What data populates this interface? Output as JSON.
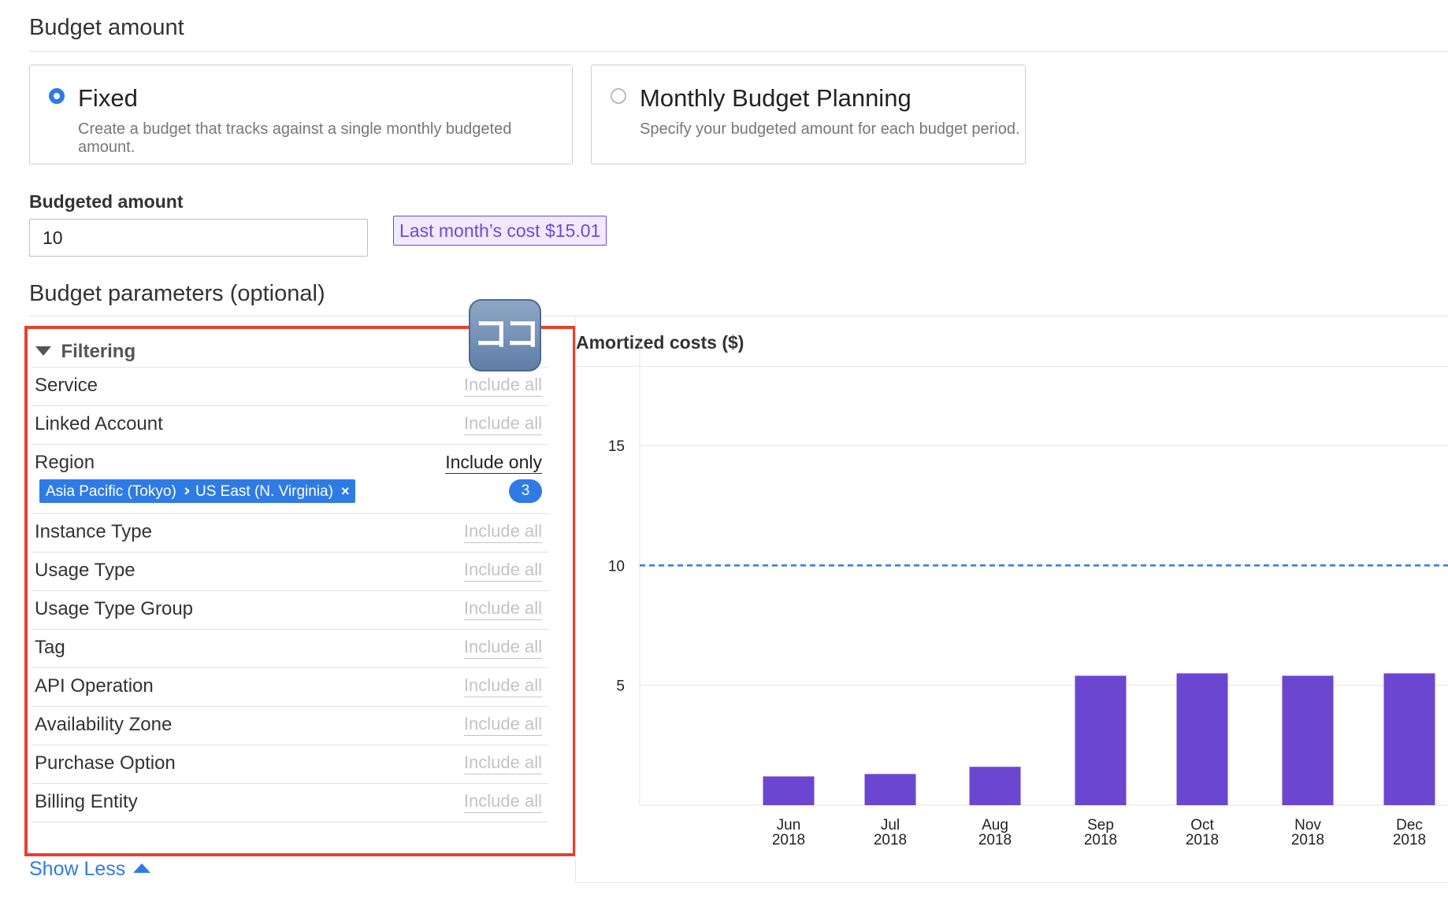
{
  "budget_amount": {
    "heading": "Budget amount",
    "options": [
      {
        "title": "Fixed",
        "description": "Create a budget that tracks against a single monthly budgeted amount.",
        "selected": true
      },
      {
        "title": "Monthly Budget Planning",
        "description": "Specify your budgeted amount for each budget period.",
        "selected": false
      }
    ],
    "budgeted_label": "Budgeted amount",
    "budgeted_value": "10",
    "last_month_cost": "Last month’s cost $15.01"
  },
  "parameters": {
    "heading": "Budget parameters (optional)",
    "filtering": {
      "title": "Filtering",
      "rows": [
        {
          "name": "Service",
          "value": "Include all"
        },
        {
          "name": "Linked Account",
          "value": "Include all"
        },
        {
          "name": "Region",
          "value": "Include only",
          "chips": [
            "Asia Pacific (Tokyo)",
            "US East (N. Virginia)"
          ],
          "count": "3"
        },
        {
          "name": "Instance Type",
          "value": "Include all"
        },
        {
          "name": "Usage Type",
          "value": "Include all"
        },
        {
          "name": "Usage Type Group",
          "value": "Include all"
        },
        {
          "name": "Tag",
          "value": "Include all"
        },
        {
          "name": "API Operation",
          "value": "Include all"
        },
        {
          "name": "Availability Zone",
          "value": "Include all"
        },
        {
          "name": "Purchase Option",
          "value": "Include all"
        },
        {
          "name": "Billing Entity",
          "value": "Include all"
        }
      ],
      "chip_remove_glyph": "×"
    },
    "koko_icon": "ココ",
    "show_less": "Show Less"
  },
  "colors": {
    "accent": "#2f7be6",
    "bar": "#6b46d1",
    "highlight_box": "#e8402b",
    "budget_line": "#2f7be6"
  },
  "chart_data": {
    "type": "bar",
    "title": "Amortized costs ($)",
    "categories": [
      [
        "Jun",
        "2018"
      ],
      [
        "Jul",
        "2018"
      ],
      [
        "Aug",
        "2018"
      ],
      [
        "Sep",
        "2018"
      ],
      [
        "Oct",
        "2018"
      ],
      [
        "Nov",
        "2018"
      ],
      [
        "Dec",
        "2018"
      ]
    ],
    "values": [
      1.2,
      1.3,
      1.6,
      5.4,
      5.5,
      5.4,
      5.5
    ],
    "budget_line": 10,
    "yticks": [
      5,
      10,
      15
    ],
    "ylim": [
      0,
      17.5
    ],
    "grid": true
  }
}
